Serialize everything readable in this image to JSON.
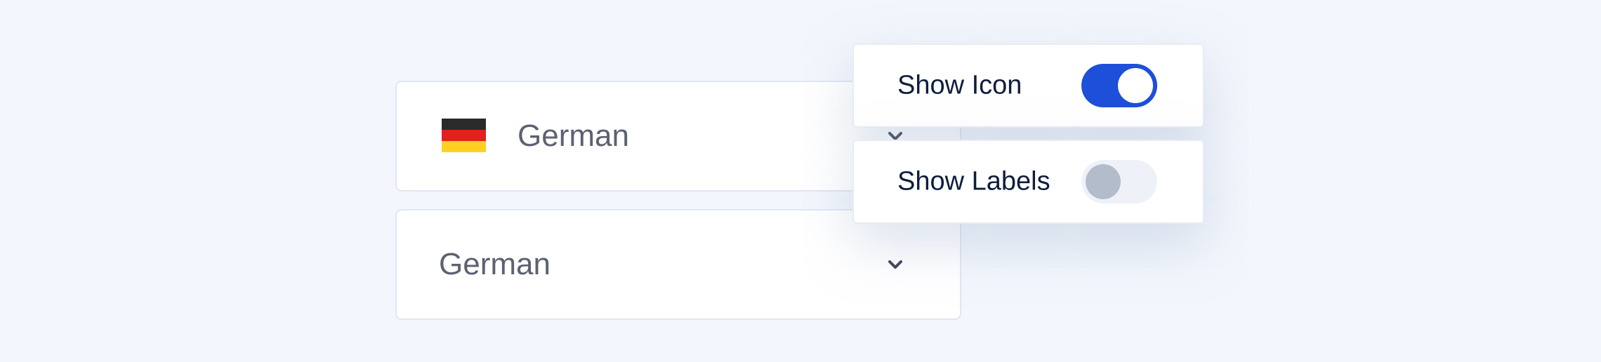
{
  "selects": [
    {
      "id": "with-icon",
      "value": "German",
      "show_flag": true,
      "flag_icon": "germany-flag-icon",
      "flag_colors": [
        "#2a2a2a",
        "#e0211c",
        "#ffd021"
      ],
      "chevron_icon": "chevron-down-icon"
    },
    {
      "id": "plain",
      "value": "German",
      "show_flag": false,
      "chevron_icon": "chevron-down-icon"
    }
  ],
  "settings": {
    "show_icon": {
      "label": "Show Icon",
      "enabled": true
    },
    "show_labels": {
      "label": "Show Labels",
      "enabled": false
    }
  },
  "colors": {
    "accent": "#1d4fd8",
    "toggle_off_track": "#eef2f8",
    "toggle_off_knob": "#b3bccb",
    "text_primary": "#0f1d3d",
    "text_select": "#5b6271",
    "background": "#f3f6fc"
  }
}
